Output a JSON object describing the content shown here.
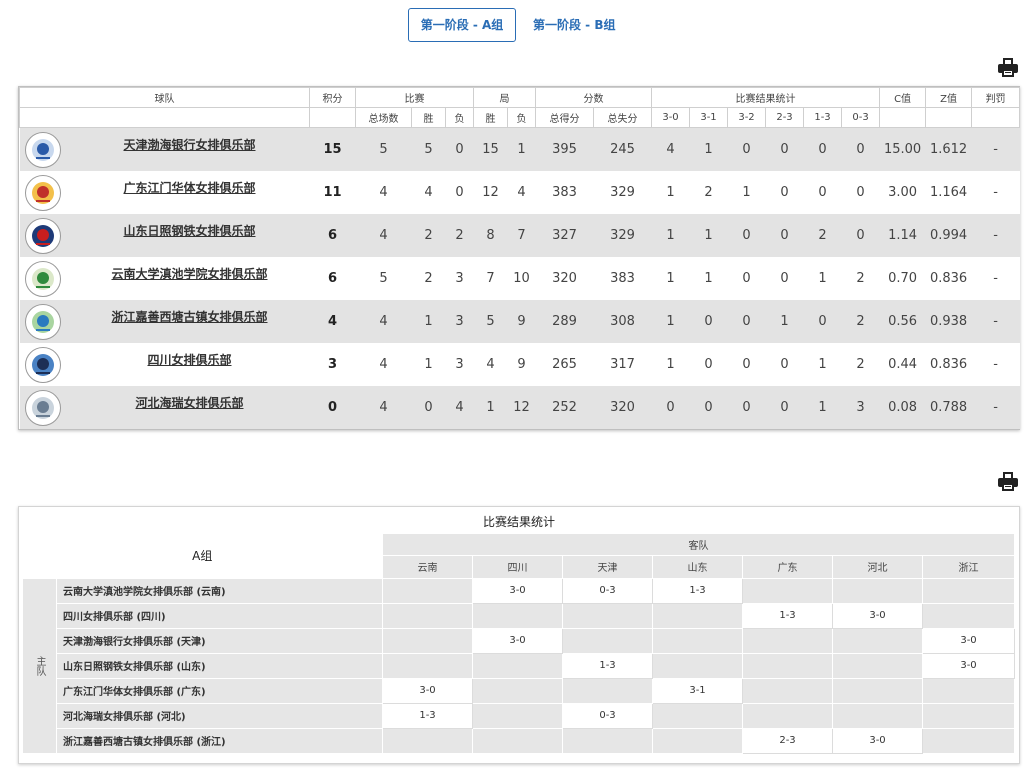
{
  "tabs": [
    {
      "label": "第一阶段 - A组",
      "active": true
    },
    {
      "label": "第一阶段 - B组",
      "active": false
    }
  ],
  "standings": {
    "headers": {
      "team": "球队",
      "points": "积分",
      "matches": "比赛",
      "sets": "局",
      "scores": "分数",
      "result_stats": "比赛结果统计",
      "c_value": "C值",
      "z_value": "Z值",
      "penalty": "判罚"
    },
    "subheaders": [
      "总场数",
      "胜",
      "负",
      "胜",
      "负",
      "总得分",
      "总失分",
      "3-0",
      "3-1",
      "3-2",
      "2-3",
      "1-3",
      "0-3"
    ],
    "rows": [
      {
        "team": "天津渤海银行女排俱乐部",
        "pts": "15",
        "played": "5",
        "w": "5",
        "l": "0",
        "sw": "15",
        "sl": "1",
        "pf": "395",
        "pa": "245",
        "r30": "4",
        "r31": "1",
        "r32": "0",
        "r23": "0",
        "r13": "0",
        "r03": "0",
        "c": "15.00",
        "z": "1.612",
        "pen": "-"
      },
      {
        "team": "广东江门华体女排俱乐部",
        "pts": "11",
        "played": "4",
        "w": "4",
        "l": "0",
        "sw": "12",
        "sl": "4",
        "pf": "383",
        "pa": "329",
        "r30": "1",
        "r31": "2",
        "r32": "1",
        "r23": "0",
        "r13": "0",
        "r03": "0",
        "c": "3.00",
        "z": "1.164",
        "pen": "-"
      },
      {
        "team": "山东日照钢铁女排俱乐部",
        "pts": "6",
        "played": "4",
        "w": "2",
        "l": "2",
        "sw": "8",
        "sl": "7",
        "pf": "327",
        "pa": "329",
        "r30": "1",
        "r31": "1",
        "r32": "0",
        "r23": "0",
        "r13": "2",
        "r03": "0",
        "c": "1.14",
        "z": "0.994",
        "pen": "-"
      },
      {
        "team": "云南大学滇池学院女排俱乐部",
        "pts": "6",
        "played": "5",
        "w": "2",
        "l": "3",
        "sw": "7",
        "sl": "10",
        "pf": "320",
        "pa": "383",
        "r30": "1",
        "r31": "1",
        "r32": "0",
        "r23": "0",
        "r13": "1",
        "r03": "2",
        "c": "0.70",
        "z": "0.836",
        "pen": "-"
      },
      {
        "team": "浙江嘉善西塘古镇女排俱乐部",
        "pts": "4",
        "played": "4",
        "w": "1",
        "l": "3",
        "sw": "5",
        "sl": "9",
        "pf": "289",
        "pa": "308",
        "r30": "1",
        "r31": "0",
        "r32": "0",
        "r23": "1",
        "r13": "0",
        "r03": "2",
        "c": "0.56",
        "z": "0.938",
        "pen": "-"
      },
      {
        "team": "四川女排俱乐部",
        "pts": "3",
        "played": "4",
        "w": "1",
        "l": "3",
        "sw": "4",
        "sl": "9",
        "pf": "265",
        "pa": "317",
        "r30": "1",
        "r31": "0",
        "r32": "0",
        "r23": "0",
        "r13": "1",
        "r03": "2",
        "c": "0.44",
        "z": "0.836",
        "pen": "-"
      },
      {
        "team": "河北海瑞女排俱乐部",
        "pts": "0",
        "played": "4",
        "w": "0",
        "l": "4",
        "sw": "1",
        "sl": "12",
        "pf": "252",
        "pa": "320",
        "r30": "0",
        "r31": "0",
        "r32": "0",
        "r23": "0",
        "r13": "1",
        "r03": "3",
        "c": "0.08",
        "z": "0.788",
        "pen": "-"
      }
    ]
  },
  "matrix": {
    "title": "比赛结果统计",
    "group": "A组",
    "away_label": "客队",
    "home_label": "主队",
    "columns": [
      "云南",
      "四川",
      "天津",
      "山东",
      "广东",
      "河北",
      "浙江"
    ],
    "rows": [
      {
        "label": "云南大学滇池学院女排俱乐部 (云南)",
        "cells": [
          "",
          "3-0",
          "0-3",
          "1-3",
          "",
          "",
          ""
        ]
      },
      {
        "label": "四川女排俱乐部 (四川)",
        "cells": [
          "",
          "",
          "",
          "",
          "1-3",
          "3-0",
          ""
        ]
      },
      {
        "label": "天津渤海银行女排俱乐部 (天津)",
        "cells": [
          "",
          "3-0",
          "",
          "",
          "",
          "",
          "3-0"
        ]
      },
      {
        "label": "山东日照钢铁女排俱乐部 (山东)",
        "cells": [
          "",
          "",
          "1-3",
          "",
          "",
          "",
          "3-0"
        ]
      },
      {
        "label": "广东江门华体女排俱乐部 (广东)",
        "cells": [
          "3-0",
          "",
          "",
          "3-1",
          "",
          "",
          ""
        ]
      },
      {
        "label": "河北海瑞女排俱乐部 (河北)",
        "cells": [
          "1-3",
          "",
          "0-3",
          "",
          "",
          "",
          ""
        ]
      },
      {
        "label": "浙江嘉善西塘古镇女排俱乐部 (浙江)",
        "cells": [
          "",
          "",
          "",
          "",
          "2-3",
          "3-0",
          ""
        ]
      }
    ]
  }
}
